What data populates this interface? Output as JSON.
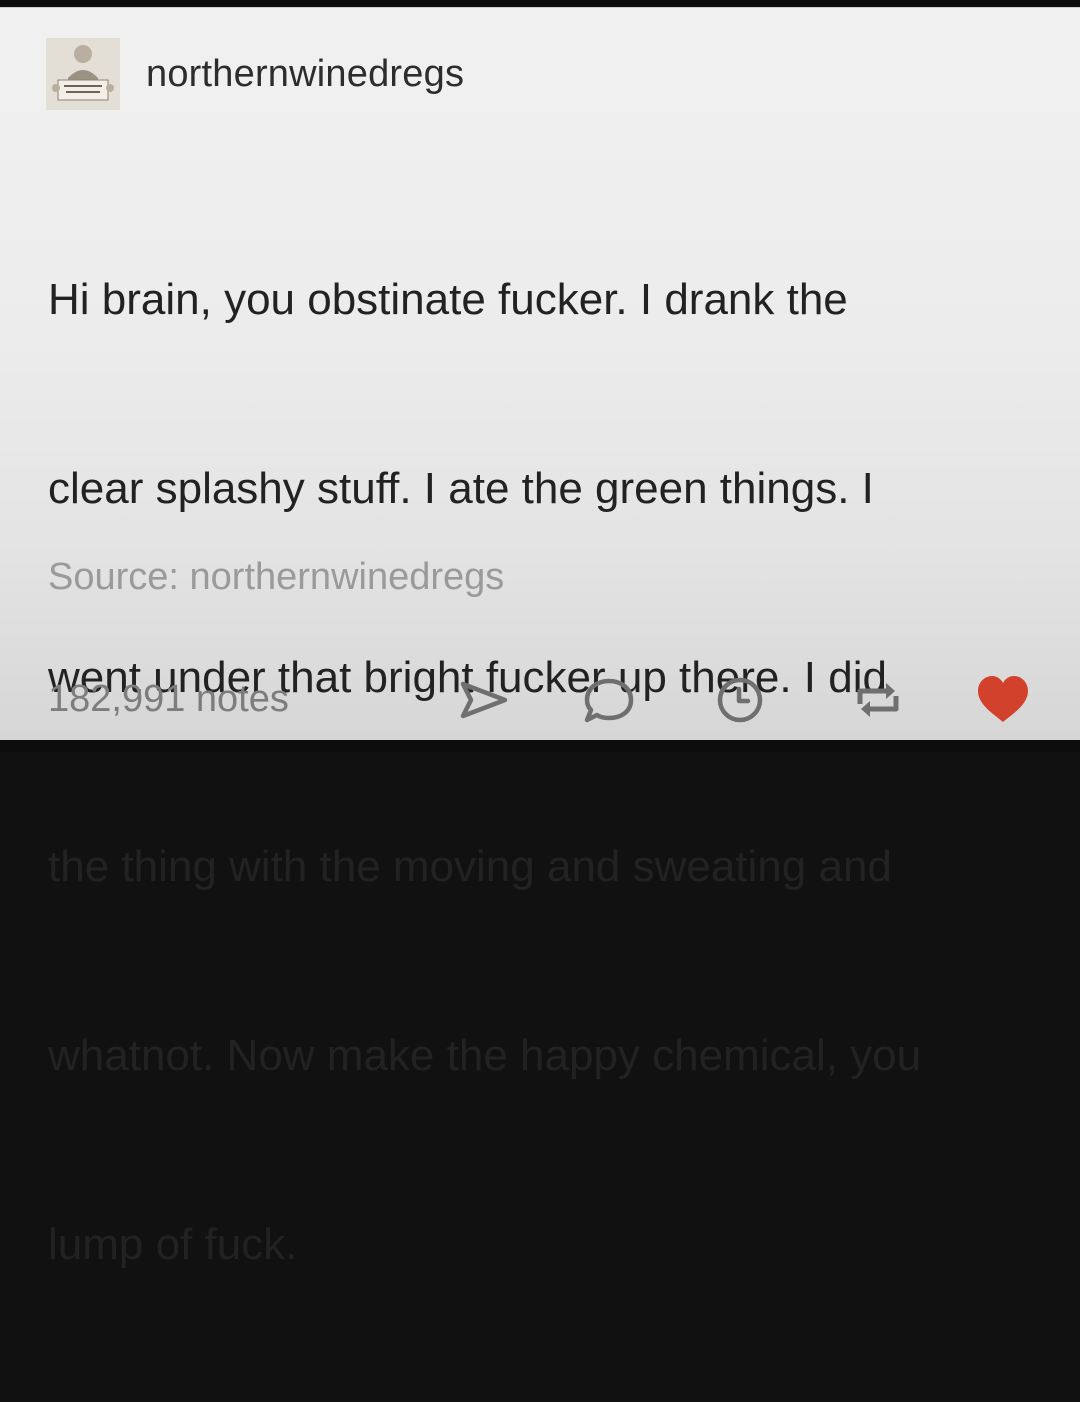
{
  "post": {
    "username": "northernwinedregs",
    "avatar_icon": "avatar-person-holding-sign-icon",
    "body_lines": [
      "Hi brain, you obstinate fucker. I drank the",
      "clear splashy stuff. I ate the green things. I",
      "went under that bright fucker up there. I did",
      "the thing with the moving and sweating and",
      "whatnot. Now make the happy chemical, you",
      "lump of fuck."
    ],
    "source_label": "Source:",
    "source_name": "northernwinedregs"
  },
  "footer": {
    "notes_label": "182,991 notes",
    "actions": [
      {
        "name": "share",
        "icon": "paper-plane-icon"
      },
      {
        "name": "reply",
        "icon": "speech-bubble-icon"
      },
      {
        "name": "queue",
        "icon": "clock-icon"
      },
      {
        "name": "reblog",
        "icon": "reblog-icon"
      },
      {
        "name": "like",
        "icon": "heart-icon"
      }
    ]
  },
  "colors": {
    "icon_gray": "#6f6f6f",
    "like_red": "#d2412b",
    "text": "#222222",
    "muted": "#9a9a9a"
  }
}
